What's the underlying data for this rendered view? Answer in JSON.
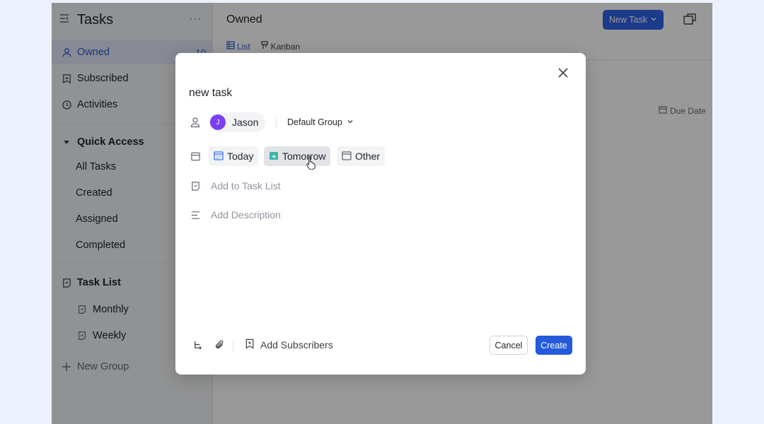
{
  "sidebar": {
    "title": "Tasks",
    "more": "···",
    "items": [
      {
        "label": "Owned",
        "count": "10"
      },
      {
        "label": "Subscribed"
      },
      {
        "label": "Activities"
      }
    ],
    "quick_access": {
      "label": "Quick Access",
      "items": [
        "All Tasks",
        "Created",
        "Assigned",
        "Completed"
      ]
    },
    "task_list": {
      "label": "Task List",
      "items": [
        "Monthly",
        "Weekly"
      ]
    },
    "new_group": "New Group"
  },
  "main": {
    "title": "Owned",
    "new_task_label": "New Task",
    "tabs": [
      {
        "label": "List"
      },
      {
        "label": "Kanban"
      }
    ],
    "due_date_label": "Due Date"
  },
  "modal": {
    "task_title": "new task",
    "assignee": {
      "initial": "J",
      "name": "Jason"
    },
    "group": "Default Group",
    "dates": [
      "Today",
      "Tomorrow",
      "Other"
    ],
    "add_task_list": "Add to Task List",
    "add_description": "Add Description",
    "footer": {
      "add_subscribers": "Add Subscribers",
      "cancel": "Cancel",
      "create": "Create"
    }
  },
  "colors": {
    "accent": "#2f63e7",
    "avatar": "#7b3ff2",
    "page_bg": "#edf1fe"
  }
}
